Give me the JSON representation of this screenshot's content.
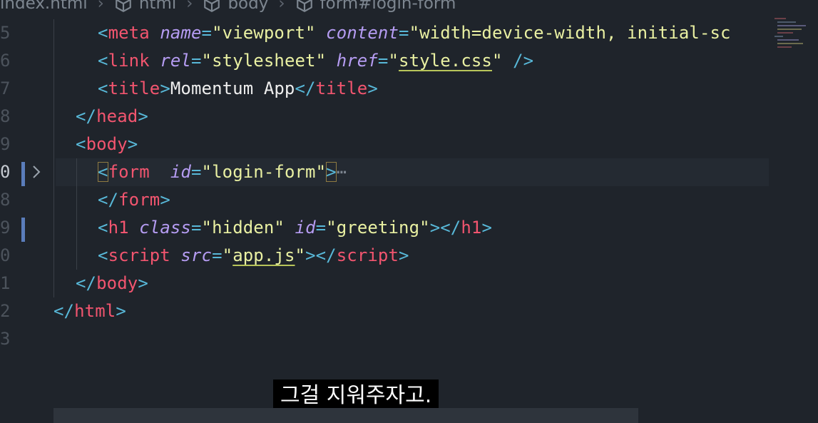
{
  "breadcrumb": [
    {
      "label": "index.html",
      "icon": null
    },
    {
      "label": "html",
      "icon": "cube-icon"
    },
    {
      "label": "body",
      "icon": "cube-icon"
    },
    {
      "label": "form#login-form",
      "icon": "cube-icon"
    }
  ],
  "gutter": [
    "5",
    "6",
    "7",
    "8",
    "9",
    "0",
    "8",
    "9",
    "0",
    "1",
    "2",
    "3"
  ],
  "code": {
    "meta_tag": "meta",
    "meta_attr_name": "name",
    "meta_val_name": "\"viewport\"",
    "meta_attr_content": "content",
    "meta_val_content": "\"width=device-width, initial-sc",
    "link_tag": "link",
    "link_attr_rel": "rel",
    "link_val_rel": "\"stylesheet\"",
    "link_attr_href": "href",
    "link_val_href": "style.css",
    "title_tag": "title",
    "title_text": "Momentum App",
    "head_tag": "head",
    "body_tag": "body",
    "form_tag": "form",
    "form_attr_id": "id",
    "form_val_id": "\"login-form\"",
    "folded": "⋯",
    "h1_tag": "h1",
    "h1_attr_class": "class",
    "h1_val_class": "\"hidden\"",
    "h1_attr_id": "id",
    "h1_val_id": "\"greeting\"",
    "script_tag": "script",
    "script_attr_src": "src",
    "script_val_src": "app.js",
    "html_tag": "html"
  },
  "subtitle": "그걸 지워주자고.",
  "colors": {
    "background": "#1f242b",
    "tag": "#f2556f",
    "punctuation": "#58b8d8",
    "attribute": "#b59cf2",
    "string": "#e9f0a2"
  }
}
